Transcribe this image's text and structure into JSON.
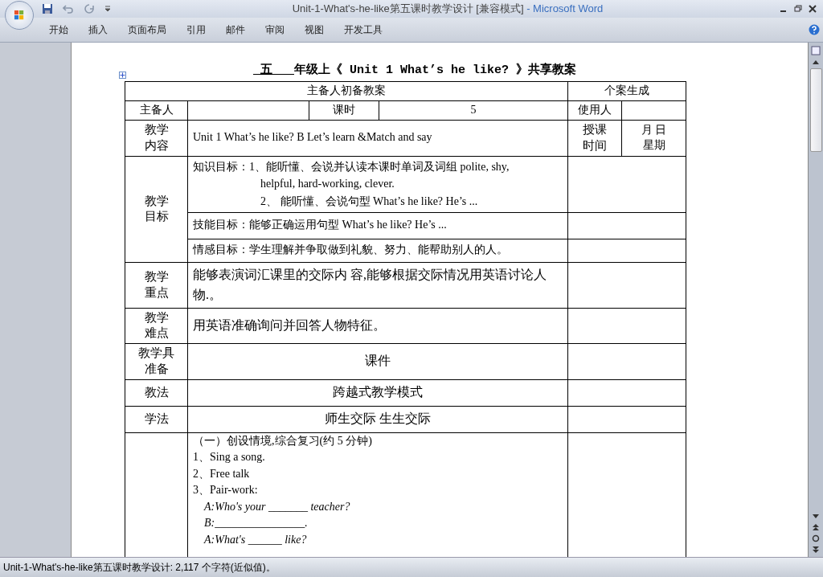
{
  "window": {
    "title_doc": "Unit-1-What's-he-like第五课时教学设计 [兼容模式]",
    "title_app": " - Microsoft Word"
  },
  "ribbon_tabs": [
    {
      "label": "开始",
      "selected": false
    },
    {
      "label": "插入",
      "selected": false
    },
    {
      "label": "页面布局",
      "selected": false
    },
    {
      "label": "引用",
      "selected": false
    },
    {
      "label": "邮件",
      "selected": false
    },
    {
      "label": "审阅",
      "selected": false
    },
    {
      "label": "视图",
      "selected": false
    },
    {
      "label": "开发工具",
      "selected": false
    }
  ],
  "document": {
    "title_grade": "五",
    "title_rest": "年级上《 Unit 1 What’s he like? 》共享教案",
    "header": {
      "main": "主备人初备教案",
      "side": "个案生成"
    },
    "info": {
      "preparer_label": "主备人",
      "period_label": "课时",
      "period": "5",
      "user_label": "使用人"
    },
    "content": {
      "label": "教学内容",
      "text": "Unit 1 What’s he like?    B Let’s learn &Match and say",
      "time_label": "授课时间",
      "date_label": "月  日",
      "weekday_label": "星期"
    },
    "objectives": {
      "label": "教学目标",
      "knowledge": [
        "知识目标：1、能听懂、会说并认读本课时单词及词组 polite, shy,",
        "helpful,   hard-working, clever.",
        "2、  能听懂、会说句型 What’s he like? He’s ..."
      ],
      "skill": "技能目标：能够正确运用句型 What’s he like? He’s ...",
      "emotion": "情感目标：学生理解并争取做到礼貌、努力、能帮助别人的人。"
    },
    "rows": [
      {
        "label": "教学重点",
        "text": "能够表演词汇课里的交际内 容,能够根据交际情况用英语讨论人物.。",
        "centered": false
      },
      {
        "label": "教学难点",
        "text": "用英语准确询问并回答人物特征。",
        "centered": false
      },
      {
        "label": "教学具准备",
        "text": "课件",
        "centered": true
      },
      {
        "label": "教法",
        "text": "跨越式教学模式",
        "centered": true
      },
      {
        "label": "学法",
        "text": "师生交际  生生交际",
        "centered": true
      }
    ],
    "process": [
      {
        "text": "（一）创设情境,综合复习(约 5 分钟)",
        "italic": false
      },
      {
        "text": "1、Sing a song.",
        "italic": false
      },
      {
        "text": "2、Free talk",
        "italic": false
      },
      {
        "text": "3、Pair-work:",
        "italic": false
      },
      {
        "text": "A:Who's your _______ teacher?",
        "italic": true
      },
      {
        "text": "B:________________.",
        "italic": true
      },
      {
        "text": "A:What's ______ like?",
        "italic": true
      }
    ]
  },
  "status_bar": "Unit-1-What's-he-like第五课时教学设计: 2,117 个字符(近似值)。"
}
